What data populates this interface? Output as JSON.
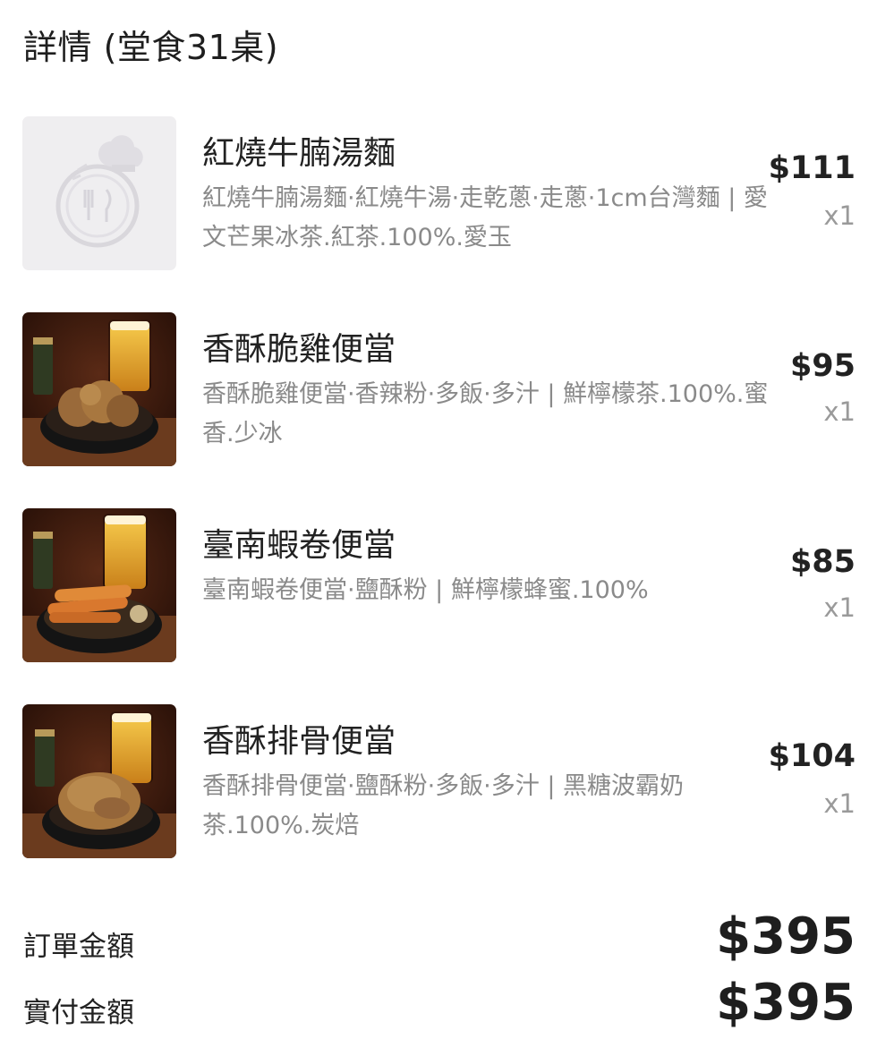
{
  "header": {
    "title": "詳情 (堂食31桌)"
  },
  "items": [
    {
      "name": "紅燒牛腩湯麵",
      "description": "紅燒牛腩湯麵·紅燒牛湯·走乾蔥·走蔥·1cm台灣麵 | 愛文芒果冰茶.紅茶.100%.愛玉",
      "price": "$111",
      "qty": "x1",
      "image": "placeholder-chef-plate-icon"
    },
    {
      "name": "香酥脆雞便當",
      "description": "香酥脆雞便當·香辣粉·多飯·多汁 | 鮮檸檬茶.100%.蜜香.少冰",
      "price": "$95",
      "qty": "x1",
      "image": "fried-chicken-bento-photo"
    },
    {
      "name": "臺南蝦卷便當",
      "description": "臺南蝦卷便當·鹽酥粉 | 鮮檸檬蜂蜜.100%",
      "price": "$85",
      "qty": "x1",
      "image": "shrimp-roll-bento-photo"
    },
    {
      "name": "香酥排骨便當",
      "description": "香酥排骨便當·鹽酥粉·多飯·多汁 | 黑糖波霸奶茶.100%.炭焙",
      "price": "$104",
      "qty": "x1",
      "image": "pork-chop-bento-photo"
    }
  ],
  "summary": {
    "order_amount_label": "訂單金額",
    "order_amount_value": "$395",
    "paid_amount_label": "實付金額",
    "paid_amount_value": "$395"
  },
  "colors": {
    "text_primary": "#222222",
    "text_secondary": "#8a8a8a",
    "placeholder_bg": "#efeef0"
  }
}
